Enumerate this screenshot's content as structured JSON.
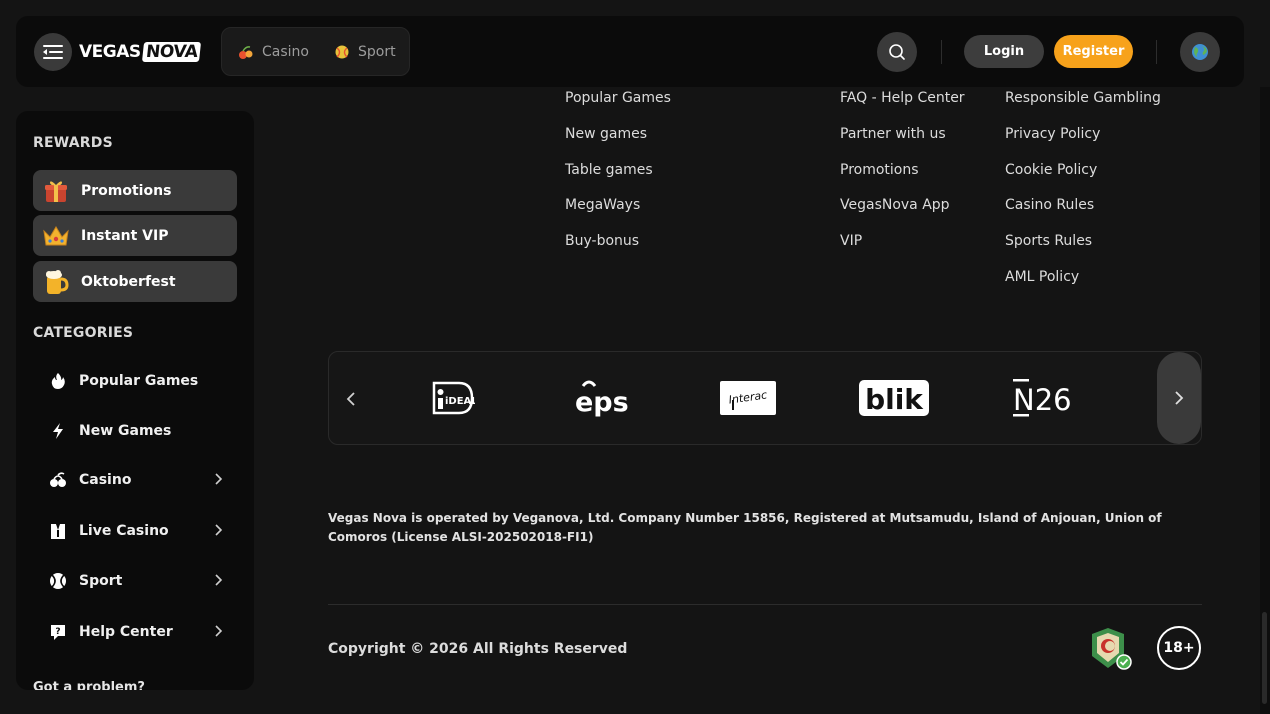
{
  "header": {
    "logo_part1": "VEGAS",
    "logo_part2": "NOVA",
    "modes": [
      {
        "label": "Casino"
      },
      {
        "label": "Sport"
      }
    ],
    "login_label": "Login",
    "register_label": "Register"
  },
  "sidebar": {
    "rewards_title": "REWARDS",
    "rewards": [
      {
        "label": "Promotions",
        "icon": "gift-icon"
      },
      {
        "label": "Instant VIP",
        "icon": "crown-icon"
      },
      {
        "label": "Oktoberfest",
        "icon": "beer-icon"
      }
    ],
    "categories_title": "CATEGORIES",
    "categories": [
      {
        "label": "Popular Games",
        "icon": "fire-icon"
      },
      {
        "label": "New Games",
        "icon": "lightning-icon"
      },
      {
        "label": "Casino",
        "icon": "cherries-icon"
      },
      {
        "label": "Live Casino",
        "icon": "dealer-icon"
      },
      {
        "label": "Sport",
        "icon": "tennis-ball-icon"
      },
      {
        "label": "Help Center",
        "icon": "help-chat-icon"
      }
    ],
    "problem_label": "Got a problem?"
  },
  "footer": {
    "col1": [
      "Popular Games",
      "New games",
      "Table games",
      "MegaWays",
      "Buy-bonus"
    ],
    "col2": [
      "FAQ - Help Center",
      "Partner with us",
      "Promotions",
      "VegasNova App",
      "VIP"
    ],
    "col3": [
      "Responsible Gambling",
      "Privacy Policy",
      "Cookie Policy",
      "Casino Rules",
      "Sports Rules",
      "AML Policy"
    ],
    "payments": [
      "iDEAL",
      "eps",
      "Interac",
      "blik",
      "N26"
    ],
    "legal": "Vegas Nova is operated by Veganova, Ltd. Company Number 15856, Registered at Mutsamudu, Island of Anjouan, Union of Comoros (License ALSI-202502018-FI1)",
    "copyright": "Copyright © 2026 All Rights Reserved",
    "age_badge": "18+"
  },
  "colors": {
    "accent": "#f7a21b",
    "background": "#141414",
    "panel": "#0b0b0b",
    "button": "#3a3a3a"
  }
}
